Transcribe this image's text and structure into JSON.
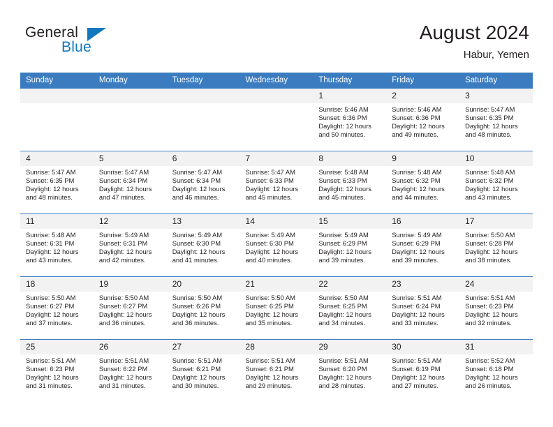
{
  "brand": {
    "name_top": "General",
    "name_bottom": "Blue",
    "accent_color": "#1277bd"
  },
  "header": {
    "title": "August 2024",
    "subtitle": "Habur, Yemen",
    "header_bg_color": "#3b7cc0",
    "daynum_bg_color": "#f2f2f2"
  },
  "weekday_headers": [
    "Sunday",
    "Monday",
    "Tuesday",
    "Wednesday",
    "Thursday",
    "Friday",
    "Saturday"
  ],
  "labels": {
    "sunrise_prefix": "Sunrise:",
    "sunset_prefix": "Sunset:",
    "daylight_prefix": "Daylight:"
  },
  "weeks": [
    [
      {
        "day": "",
        "lines": []
      },
      {
        "day": "",
        "lines": []
      },
      {
        "day": "",
        "lines": []
      },
      {
        "day": "",
        "lines": []
      },
      {
        "day": "1",
        "lines": [
          "Sunrise: 5:46 AM",
          "Sunset: 6:36 PM",
          "Daylight: 12 hours",
          "and 50 minutes."
        ]
      },
      {
        "day": "2",
        "lines": [
          "Sunrise: 5:46 AM",
          "Sunset: 6:36 PM",
          "Daylight: 12 hours",
          "and 49 minutes."
        ]
      },
      {
        "day": "3",
        "lines": [
          "Sunrise: 5:47 AM",
          "Sunset: 6:35 PM",
          "Daylight: 12 hours",
          "and 48 minutes."
        ]
      }
    ],
    [
      {
        "day": "4",
        "lines": [
          "Sunrise: 5:47 AM",
          "Sunset: 6:35 PM",
          "Daylight: 12 hours",
          "and 48 minutes."
        ]
      },
      {
        "day": "5",
        "lines": [
          "Sunrise: 5:47 AM",
          "Sunset: 6:34 PM",
          "Daylight: 12 hours",
          "and 47 minutes."
        ]
      },
      {
        "day": "6",
        "lines": [
          "Sunrise: 5:47 AM",
          "Sunset: 6:34 PM",
          "Daylight: 12 hours",
          "and 46 minutes."
        ]
      },
      {
        "day": "7",
        "lines": [
          "Sunrise: 5:47 AM",
          "Sunset: 6:33 PM",
          "Daylight: 12 hours",
          "and 45 minutes."
        ]
      },
      {
        "day": "8",
        "lines": [
          "Sunrise: 5:48 AM",
          "Sunset: 6:33 PM",
          "Daylight: 12 hours",
          "and 45 minutes."
        ]
      },
      {
        "day": "9",
        "lines": [
          "Sunrise: 5:48 AM",
          "Sunset: 6:32 PM",
          "Daylight: 12 hours",
          "and 44 minutes."
        ]
      },
      {
        "day": "10",
        "lines": [
          "Sunrise: 5:48 AM",
          "Sunset: 6:32 PM",
          "Daylight: 12 hours",
          "and 43 minutes."
        ]
      }
    ],
    [
      {
        "day": "11",
        "lines": [
          "Sunrise: 5:48 AM",
          "Sunset: 6:31 PM",
          "Daylight: 12 hours",
          "and 43 minutes."
        ]
      },
      {
        "day": "12",
        "lines": [
          "Sunrise: 5:49 AM",
          "Sunset: 6:31 PM",
          "Daylight: 12 hours",
          "and 42 minutes."
        ]
      },
      {
        "day": "13",
        "lines": [
          "Sunrise: 5:49 AM",
          "Sunset: 6:30 PM",
          "Daylight: 12 hours",
          "and 41 minutes."
        ]
      },
      {
        "day": "14",
        "lines": [
          "Sunrise: 5:49 AM",
          "Sunset: 6:30 PM",
          "Daylight: 12 hours",
          "and 40 minutes."
        ]
      },
      {
        "day": "15",
        "lines": [
          "Sunrise: 5:49 AM",
          "Sunset: 6:29 PM",
          "Daylight: 12 hours",
          "and 39 minutes."
        ]
      },
      {
        "day": "16",
        "lines": [
          "Sunrise: 5:49 AM",
          "Sunset: 6:29 PM",
          "Daylight: 12 hours",
          "and 39 minutes."
        ]
      },
      {
        "day": "17",
        "lines": [
          "Sunrise: 5:50 AM",
          "Sunset: 6:28 PM",
          "Daylight: 12 hours",
          "and 38 minutes."
        ]
      }
    ],
    [
      {
        "day": "18",
        "lines": [
          "Sunrise: 5:50 AM",
          "Sunset: 6:27 PM",
          "Daylight: 12 hours",
          "and 37 minutes."
        ]
      },
      {
        "day": "19",
        "lines": [
          "Sunrise: 5:50 AM",
          "Sunset: 6:27 PM",
          "Daylight: 12 hours",
          "and 36 minutes."
        ]
      },
      {
        "day": "20",
        "lines": [
          "Sunrise: 5:50 AM",
          "Sunset: 6:26 PM",
          "Daylight: 12 hours",
          "and 36 minutes."
        ]
      },
      {
        "day": "21",
        "lines": [
          "Sunrise: 5:50 AM",
          "Sunset: 6:25 PM",
          "Daylight: 12 hours",
          "and 35 minutes."
        ]
      },
      {
        "day": "22",
        "lines": [
          "Sunrise: 5:50 AM",
          "Sunset: 6:25 PM",
          "Daylight: 12 hours",
          "and 34 minutes."
        ]
      },
      {
        "day": "23",
        "lines": [
          "Sunrise: 5:51 AM",
          "Sunset: 6:24 PM",
          "Daylight: 12 hours",
          "and 33 minutes."
        ]
      },
      {
        "day": "24",
        "lines": [
          "Sunrise: 5:51 AM",
          "Sunset: 6:23 PM",
          "Daylight: 12 hours",
          "and 32 minutes."
        ]
      }
    ],
    [
      {
        "day": "25",
        "lines": [
          "Sunrise: 5:51 AM",
          "Sunset: 6:23 PM",
          "Daylight: 12 hours",
          "and 31 minutes."
        ]
      },
      {
        "day": "26",
        "lines": [
          "Sunrise: 5:51 AM",
          "Sunset: 6:22 PM",
          "Daylight: 12 hours",
          "and 31 minutes."
        ]
      },
      {
        "day": "27",
        "lines": [
          "Sunrise: 5:51 AM",
          "Sunset: 6:21 PM",
          "Daylight: 12 hours",
          "and 30 minutes."
        ]
      },
      {
        "day": "28",
        "lines": [
          "Sunrise: 5:51 AM",
          "Sunset: 6:21 PM",
          "Daylight: 12 hours",
          "and 29 minutes."
        ]
      },
      {
        "day": "29",
        "lines": [
          "Sunrise: 5:51 AM",
          "Sunset: 6:20 PM",
          "Daylight: 12 hours",
          "and 28 minutes."
        ]
      },
      {
        "day": "30",
        "lines": [
          "Sunrise: 5:51 AM",
          "Sunset: 6:19 PM",
          "Daylight: 12 hours",
          "and 27 minutes."
        ]
      },
      {
        "day": "31",
        "lines": [
          "Sunrise: 5:52 AM",
          "Sunset: 6:18 PM",
          "Daylight: 12 hours",
          "and 26 minutes."
        ]
      }
    ]
  ]
}
